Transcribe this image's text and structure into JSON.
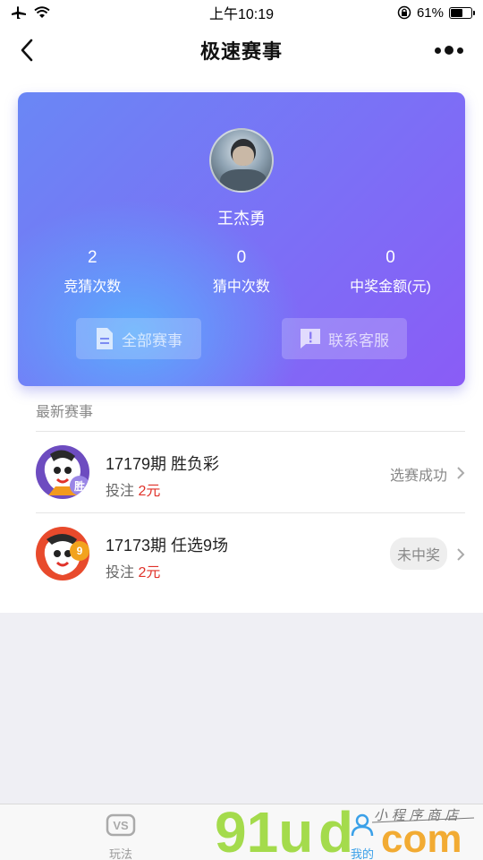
{
  "status_bar": {
    "time": "上午10:19",
    "battery": "61%",
    "battery_level": 0.61
  },
  "nav": {
    "title": "极速赛事",
    "back_icon": "chevron-left-icon",
    "more_icon": "more-dots-icon"
  },
  "profile": {
    "name": "王杰勇",
    "stats": [
      {
        "value": "2",
        "label": "竞猜次数"
      },
      {
        "value": "0",
        "label": "猜中次数"
      },
      {
        "value": "0",
        "label": "中奖金额(元)"
      }
    ],
    "buttons": {
      "all_matches": "全部赛事",
      "contact_service": "联系客服"
    }
  },
  "recent": {
    "title": "最新赛事",
    "items": [
      {
        "title": "17179期 胜负彩",
        "bet_label": "投注",
        "amount": "2元",
        "status": "选赛成功",
        "badge": "胜"
      },
      {
        "title": "17173期 任选9场",
        "bet_label": "投注",
        "amount": "2元",
        "status": "未中奖",
        "badge": "9"
      }
    ]
  },
  "tab_bar": {
    "tabs": [
      {
        "label": "玩法",
        "icon": "vs-icon"
      },
      {
        "label": "我的",
        "icon": "user-icon"
      }
    ]
  },
  "watermark": {
    "brand": "91ud.com",
    "slogan": "小程序商店"
  },
  "colors": {
    "accent_red": "#e0322a",
    "tab_active": "#3aa0e8",
    "card_gradient_start": "#5ec3ff",
    "card_gradient_end": "#8a5cf6"
  }
}
